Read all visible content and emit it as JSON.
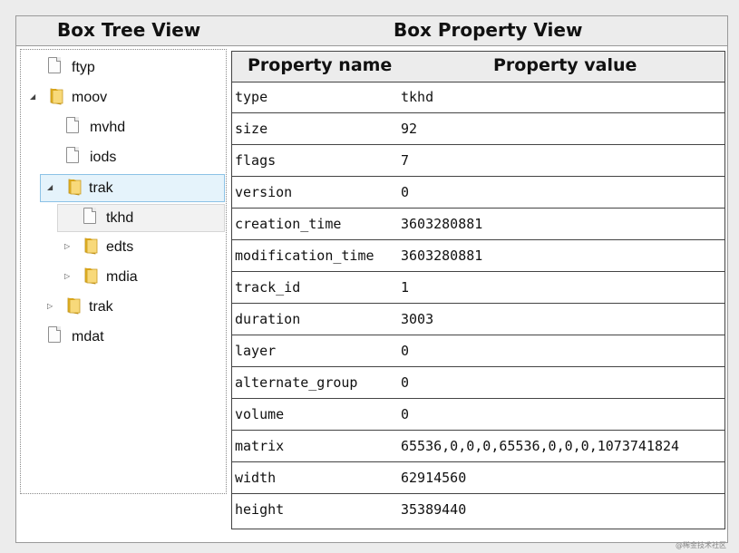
{
  "header": {
    "tree_title": "Box Tree View",
    "property_title": "Box Property View"
  },
  "tree": {
    "nodes": [
      {
        "label": "ftyp",
        "icon": "file-icon"
      },
      {
        "label": "moov",
        "icon": "folder-icon",
        "expanded": true
      },
      {
        "label": "mvhd",
        "icon": "file-icon"
      },
      {
        "label": "iods",
        "icon": "file-icon"
      },
      {
        "label": "trak",
        "icon": "folder-icon",
        "expanded": true,
        "selected": true
      },
      {
        "label": "tkhd",
        "icon": "file-icon",
        "focused": true
      },
      {
        "label": "edts",
        "icon": "folder-icon",
        "expanded": false
      },
      {
        "label": "mdia",
        "icon": "folder-icon",
        "expanded": false
      },
      {
        "label": "trak",
        "icon": "folder-icon",
        "expanded": false
      },
      {
        "label": "mdat",
        "icon": "file-icon"
      }
    ]
  },
  "properties": {
    "col_name": "Property name",
    "col_value": "Property value",
    "rows": [
      {
        "name": "type",
        "value": "tkhd"
      },
      {
        "name": "size",
        "value": "92"
      },
      {
        "name": "flags",
        "value": "7"
      },
      {
        "name": "version",
        "value": "0"
      },
      {
        "name": "creation_time",
        "value": "3603280881"
      },
      {
        "name": "modification_time",
        "value": "3603280881"
      },
      {
        "name": "track_id",
        "value": "1"
      },
      {
        "name": "duration",
        "value": "3003"
      },
      {
        "name": "layer",
        "value": "0"
      },
      {
        "name": "alternate_group",
        "value": "0"
      },
      {
        "name": "volume",
        "value": "0"
      },
      {
        "name": "matrix",
        "value": "65536,0,0,0,65536,0,0,0,1073741824"
      },
      {
        "name": "width",
        "value": "62914560"
      },
      {
        "name": "height",
        "value": "35389440"
      }
    ]
  },
  "watermark": "@稀金技术社区",
  "colors": {
    "selection_bg": "#e5f3fb",
    "selection_border": "#8cc2e6",
    "header_bg": "#ececec"
  }
}
